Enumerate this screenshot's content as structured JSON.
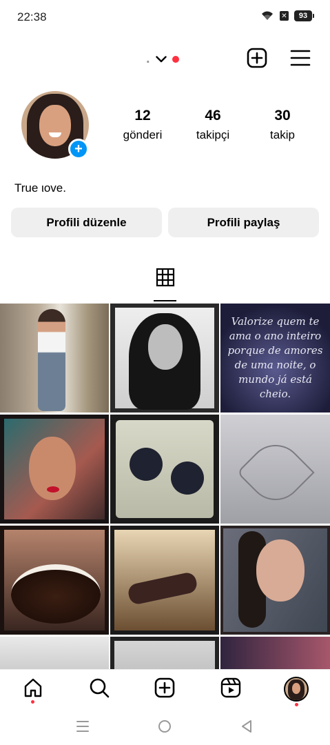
{
  "status_bar": {
    "time": "22:38",
    "battery": "93",
    "icons": [
      "wifi-icon",
      "x-badge-icon",
      "battery-icon"
    ]
  },
  "header": {
    "username": ".",
    "icons": [
      "chevron-down-icon",
      "notification-dot",
      "add-post-icon",
      "menu-icon"
    ]
  },
  "profile": {
    "stats": [
      {
        "value": "12",
        "label": "gönderi"
      },
      {
        "value": "46",
        "label": "takipçi"
      },
      {
        "value": "30",
        "label": "takip"
      }
    ],
    "bio": "True ιove.",
    "buttons": {
      "edit": "Profili düzenle",
      "share": "Profili paylaş"
    }
  },
  "tabs": {
    "active": "grid-icon"
  },
  "grid": {
    "posts": 12,
    "quote_text": "Valorize quem te ama o ano inteiro porque de amores de uma noite, o mundo já está cheio."
  },
  "bottom_nav": {
    "items": [
      "home-icon",
      "search-icon",
      "create-icon",
      "reels-icon",
      "profile-avatar"
    ]
  },
  "system_nav": {
    "items": [
      "recent-apps-icon",
      "home-circle-icon",
      "back-icon"
    ]
  },
  "colors": {
    "accent": "#0095f6",
    "notification": "#ff3040",
    "button_bg": "#efefef"
  }
}
